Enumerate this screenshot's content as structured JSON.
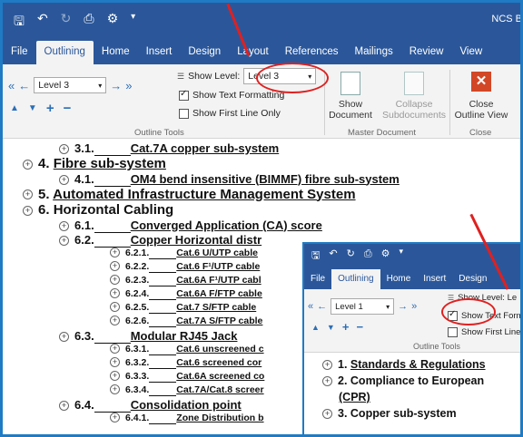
{
  "title_bar": {
    "document_title": "NCS B",
    "qat_icons": [
      "save-icon",
      "undo-icon",
      "redo-icon",
      "print-preview-icon",
      "customize-icon"
    ]
  },
  "tabs": [
    "File",
    "Outlining",
    "Home",
    "Insert",
    "Design",
    "Layout",
    "References",
    "Mailings",
    "Review",
    "View"
  ],
  "ribbon": {
    "level_value": "Level 3",
    "show_level_label": "Show Level:",
    "show_level_value": "Level 3",
    "show_text_formatting": "Show Text Formatting",
    "show_first_line_only": "Show First Line Only",
    "outline_tools_label": "Outline Tools",
    "show_document_label": [
      "Show",
      "Document"
    ],
    "collapse_subdocs_label": [
      "Collapse",
      "Subdocuments"
    ],
    "master_document_label": "Master Document",
    "close_outline_label": [
      "Close",
      "Outline View"
    ],
    "close_group_label": "Close"
  },
  "outline": [
    {
      "num": "3.1.",
      "text": "Cat.7A copper sub-system",
      "level": 2
    },
    {
      "num": "4.",
      "text": "Fibre sub-system",
      "level": 1
    },
    {
      "num": "4.1.",
      "text": "OM4 bend insensitive (BIMMF) fibre sub-system",
      "level": 2
    },
    {
      "num": "5.",
      "text": "Automated Infrastructure Management System",
      "level": 1
    },
    {
      "num": "6.",
      "text": "Horizontal Cabling",
      "level": 1
    },
    {
      "num": "6.1.",
      "text": "Converged Application (CA) score",
      "level": 2
    },
    {
      "num": "6.2.",
      "text": "Copper Horizontal distr",
      "level": 2
    },
    {
      "num": "6.2.1.",
      "text": "Cat.6 U/UTP cable",
      "level": 3
    },
    {
      "num": "6.2.2.",
      "text": "Cat.6 F¹/UTP cable",
      "level": 3
    },
    {
      "num": "6.2.3.",
      "text": "Cat.6A F¹/UTP cabl",
      "level": 3
    },
    {
      "num": "6.2.4.",
      "text": "Cat.6A F/FTP cable",
      "level": 3
    },
    {
      "num": "6.2.5.",
      "text": "Cat.7 S/FTP cable",
      "level": 3
    },
    {
      "num": "6.2.6.",
      "text": "Cat.7A S/FTP cable",
      "level": 3
    },
    {
      "num": "6.3.",
      "text": "Modular RJ45 Jack",
      "level": 2
    },
    {
      "num": "6.3.1.",
      "text": "Cat.6 unscreened c",
      "level": 3
    },
    {
      "num": "6.3.2.",
      "text": "Cat.6 screened cor",
      "level": 3
    },
    {
      "num": "6.3.3.",
      "text": "Cat.6A screened co",
      "level": 3
    },
    {
      "num": "6.3.4.",
      "text": "Cat.7A/Cat.8 screer",
      "level": 3
    },
    {
      "num": "6.4.",
      "text": "Consolidation point",
      "level": 2
    },
    {
      "num": "6.4.1.",
      "text": "Zone Distribution b",
      "level": 3
    }
  ],
  "window2": {
    "tabs": [
      "File",
      "Outlining",
      "Home",
      "Insert",
      "Design"
    ],
    "level_value": "Level 1",
    "show_level_label": "Show Level: Le",
    "show_text_formatting": "Show Text Form",
    "show_first_line_only": "Show First Line",
    "outline_tools_label": "Outline Tools",
    "outline": [
      {
        "num": "1.",
        "text": "Standards & Regulations"
      },
      {
        "num": "2.",
        "text": "Compliance to European"
      },
      {
        "num": "",
        "text": "(CPR)"
      },
      {
        "num": "3.",
        "text": "Copper sub-system"
      }
    ]
  },
  "colors": {
    "brand": "#2b579a",
    "annotation": "#e02020",
    "frame": "#1e7bc4"
  }
}
